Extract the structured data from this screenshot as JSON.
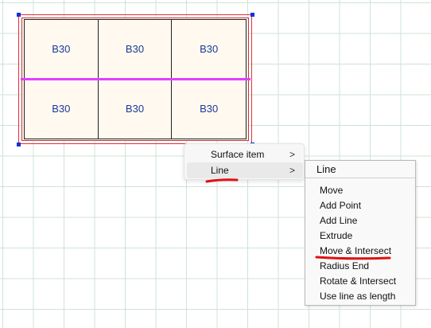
{
  "panel": {
    "cells": [
      "B30",
      "B30",
      "B30",
      "B30",
      "B30",
      "B30"
    ]
  },
  "context_menu": {
    "items": [
      {
        "label": "Surface item",
        "arrow": ">"
      },
      {
        "label": "Line",
        "arrow": ">"
      }
    ]
  },
  "submenu": {
    "title": "Line",
    "items": [
      "Move",
      "Add Point",
      "Add Line",
      "Extrude",
      "Move & Intersect",
      "Radius End",
      "Rotate & Intersect",
      "Use line as length"
    ]
  },
  "colors": {
    "slab_edge": "#e0303a",
    "mid_line": "#e040ff",
    "label_text": "#1a3a9a",
    "handle": "#1530e0",
    "annotation_underline": "#e01010"
  }
}
